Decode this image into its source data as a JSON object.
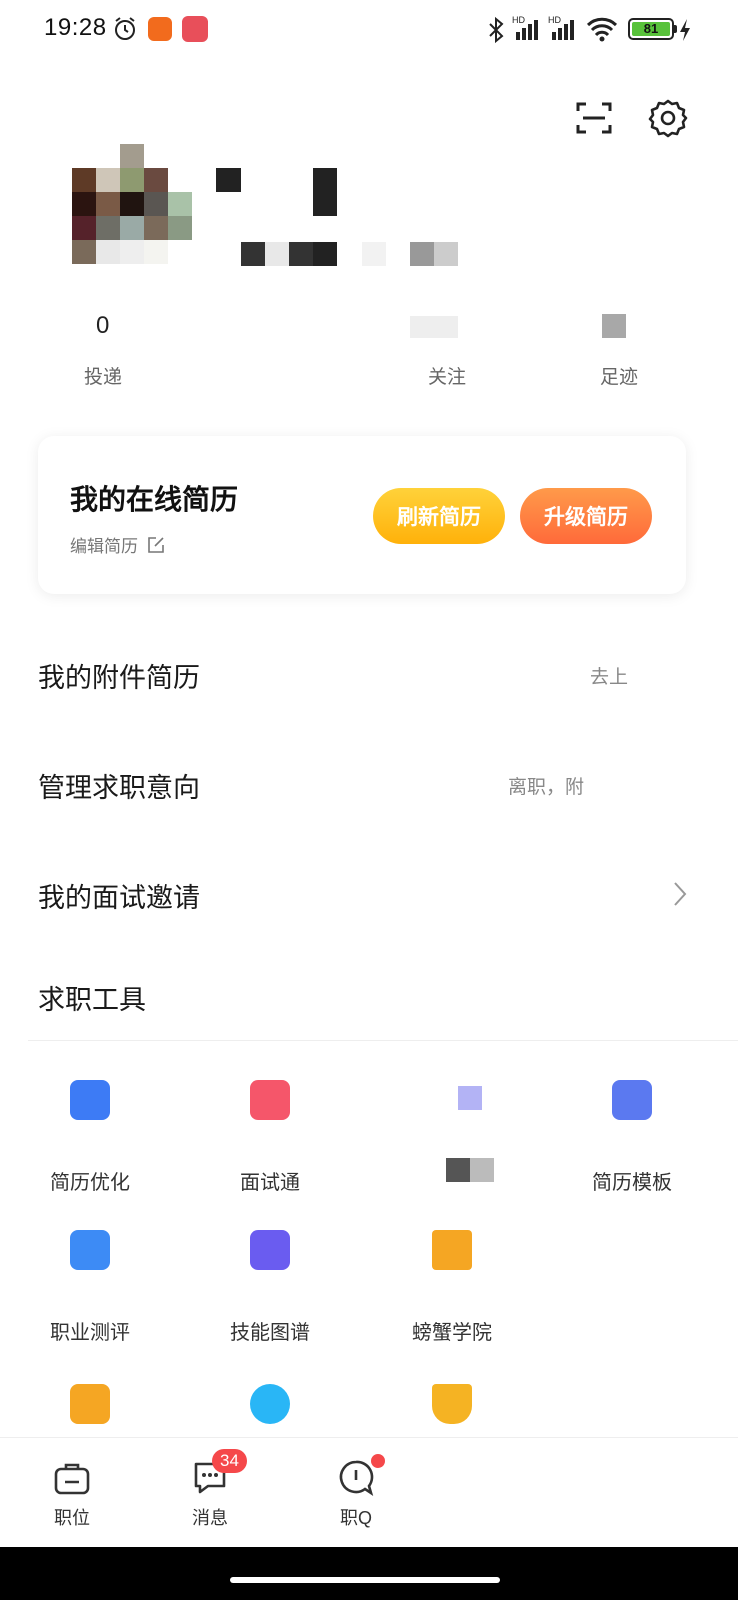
{
  "status_bar": {
    "time": "19:28",
    "battery": "81",
    "signal1": "HD",
    "signal2": "HD"
  },
  "stats": [
    {
      "value": "0",
      "label": "投递"
    },
    {
      "value": "",
      "label": "关注"
    },
    {
      "value": "",
      "label": "足迹"
    }
  ],
  "resume_card": {
    "title": "我的在线简历",
    "edit_label": "编辑简历",
    "refresh_button": "刷新简历",
    "upgrade_button": "升级简历"
  },
  "rows": [
    {
      "title": "我的附件简历",
      "right": "去上"
    },
    {
      "title": "管理求职意向",
      "right": "离职，附"
    },
    {
      "title": "我的面试邀请",
      "right": ""
    }
  ],
  "tools_section": {
    "title": "求职工具",
    "items": [
      {
        "label": "简历优化",
        "icon": "edit-icon",
        "color": "#3d7bf5"
      },
      {
        "label": "面试通",
        "icon": "book-icon",
        "color": "#f5566a"
      },
      {
        "label": "",
        "icon": "tool-icon",
        "color": "#b3b3f5"
      },
      {
        "label": "简历模板",
        "icon": "bag-icon",
        "color": "#5b79f0"
      },
      {
        "label": "职业测评",
        "icon": "monitor-chart-icon",
        "color": "#3d8bf5"
      },
      {
        "label": "技能图谱",
        "icon": "wrench-book-icon",
        "color": "#6a5cf0"
      },
      {
        "label": "螃蟹学院",
        "icon": "graduation-cap-icon",
        "color": "#f5a623"
      },
      {
        "label": "",
        "icon": "star-folder-icon",
        "color": "#f5a623"
      },
      {
        "label": "",
        "icon": "pie-chart-icon",
        "color": "#29b6f6"
      },
      {
        "label": "",
        "icon": "trophy-icon",
        "color": "#f5b323"
      }
    ]
  },
  "bottom_nav": {
    "items": [
      {
        "label": "职位",
        "icon": "briefcase-icon"
      },
      {
        "label": "消息",
        "icon": "chat-icon"
      },
      {
        "label": "职Q",
        "icon": "q-bubble-icon"
      }
    ],
    "message_badge": "34"
  }
}
